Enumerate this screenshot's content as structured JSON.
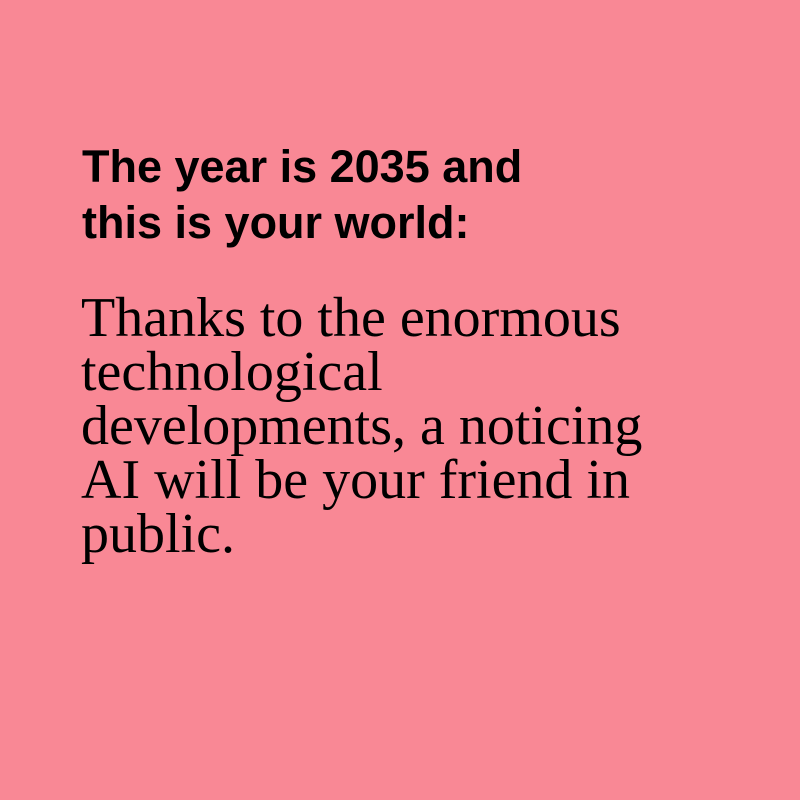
{
  "background_color": "#F98895",
  "heading": {
    "line1": "The year is 2035 and",
    "line2": "this is your world:"
  },
  "body": {
    "lines": [
      "Thanks to the enormous",
      "technological",
      "developments, a noticing",
      "AI will be your friend in",
      "public."
    ]
  }
}
